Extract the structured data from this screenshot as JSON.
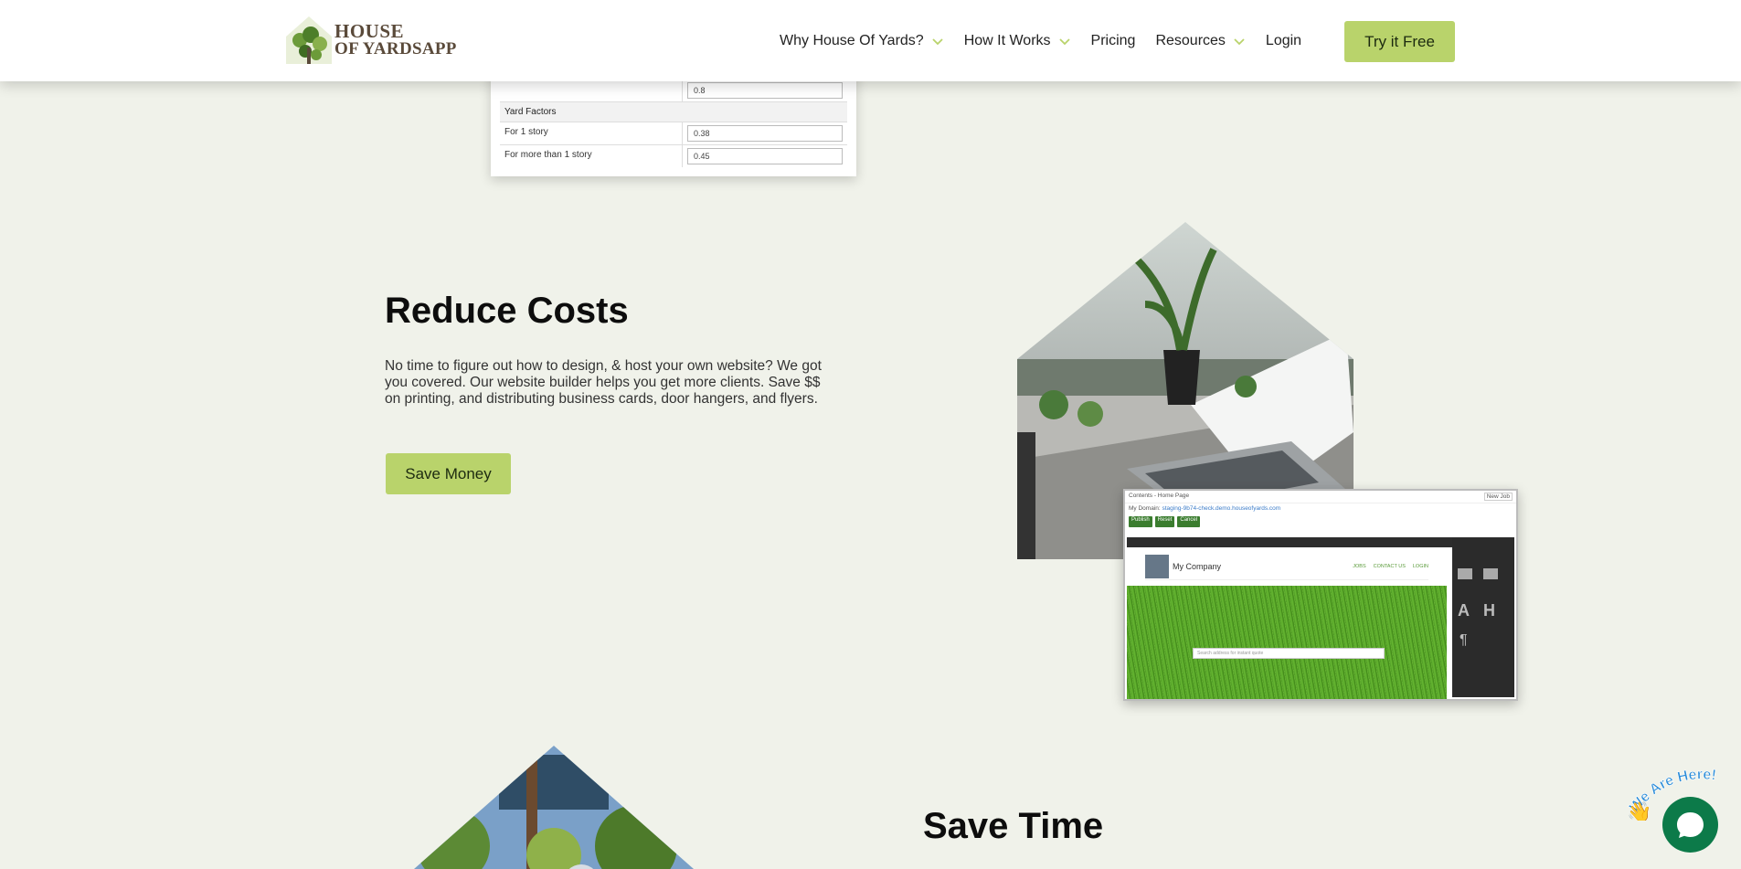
{
  "header": {
    "logo_line1": "HOUSE",
    "logo_line2": "OF YARDSAPP",
    "nav": [
      {
        "label": "Why House Of Yards?",
        "has_dropdown": true
      },
      {
        "label": "How It Works",
        "has_dropdown": true
      },
      {
        "label": "Pricing",
        "has_dropdown": false
      },
      {
        "label": "Resources",
        "has_dropdown": true
      },
      {
        "label": "Login",
        "has_dropdown": false
      }
    ],
    "cta": "Try it Free"
  },
  "table_card": {
    "top_value": "0.8",
    "section": "Yard Factors",
    "rows": [
      {
        "label": "For 1 story",
        "value": "0.38"
      },
      {
        "label": "For more than 1 story",
        "value": "0.45"
      }
    ]
  },
  "reduce_costs": {
    "title": "Reduce Costs",
    "text": "No time to figure out how to design, & host your own website? We got you covered. Our website builder helps you get more clients. Save $$ on printing, and distributing business cards, door hangers, and flyers.",
    "button": "Save Money"
  },
  "mini_screenshot": {
    "top": "Contents - Home Page",
    "top_right": "New Job",
    "domain_label": "My Domain:",
    "domain_value": "staging-9b74-check.demo.houseofyards.com",
    "buttons": [
      "Publish",
      "Reset",
      "Cancel"
    ],
    "company": "My Company",
    "links": [
      "JOBS",
      "CONTACT US",
      "LOGIN"
    ],
    "search_placeholder": "Search address for instant quote"
  },
  "save_time": {
    "title": "Save Time"
  },
  "chat": {
    "label": "We Are Here!"
  },
  "colors": {
    "accent": "#b9d36b",
    "background": "#f0f2ea",
    "chat": "#0c7a49"
  }
}
